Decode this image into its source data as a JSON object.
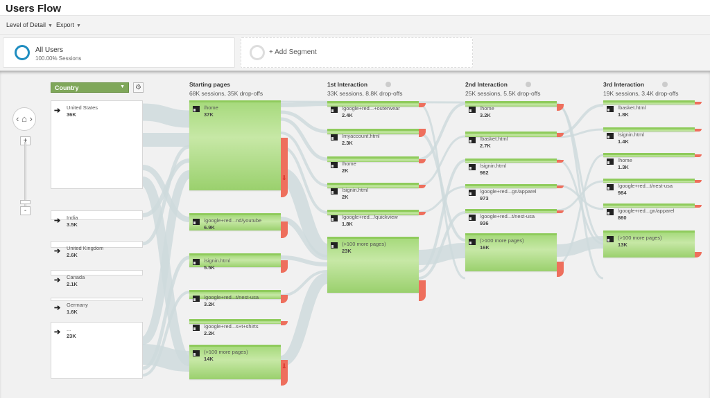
{
  "header": {
    "title": "Users Flow"
  },
  "toolbar": {
    "level_of_detail": "Level of Detail",
    "export": "Export"
  },
  "segments": [
    {
      "name": "All Users",
      "sub": "100.00% Sessions"
    },
    {
      "name": "+ Add Segment"
    }
  ],
  "dimension": {
    "selected": "Country"
  },
  "colors": {
    "node": "#9ad06d",
    "dropoff": "#ee6f5d",
    "flow": "#c9d9dc",
    "segment_ring": "#1f8dc0"
  },
  "countries": [
    {
      "label": "United States",
      "value": "36K"
    },
    {
      "label": "India",
      "value": "3.5K"
    },
    {
      "label": "United Kingdom",
      "value": "2.6K"
    },
    {
      "label": "Canada",
      "value": "2.1K"
    },
    {
      "label": "Germany",
      "value": "1.6K"
    },
    {
      "label": "...",
      "value": "23K"
    }
  ],
  "columns": [
    {
      "title": "Starting pages",
      "summary": "68K sessions, 35K drop-offs",
      "nodes": [
        {
          "label": "/home",
          "value": "37K"
        },
        {
          "label": "/google+red...nd/youtube",
          "value": "6.9K"
        },
        {
          "label": "/signin.html",
          "value": "5.5K"
        },
        {
          "label": "/google+red...t/nest-usa",
          "value": "3.2K"
        },
        {
          "label": "/google+red...s+t+shirts",
          "value": "2.2K"
        },
        {
          "label": "(>100 more pages)",
          "value": "14K"
        }
      ]
    },
    {
      "title": "1st Interaction",
      "summary": "33K sessions, 8.8K drop-offs",
      "nodes": [
        {
          "label": "/google+red...+outerwear",
          "value": "2.4K"
        },
        {
          "label": "/myaccount.html",
          "value": "2.3K"
        },
        {
          "label": "/home",
          "value": "2K"
        },
        {
          "label": "/signin.html",
          "value": "2K"
        },
        {
          "label": "/google+red.../quickview",
          "value": "1.8K"
        },
        {
          "label": "(>100 more pages)",
          "value": "23K"
        }
      ]
    },
    {
      "title": "2nd Interaction",
      "summary": "25K sessions, 5.5K drop-offs",
      "nodes": [
        {
          "label": "/home",
          "value": "3.2K"
        },
        {
          "label": "/basket.html",
          "value": "2.7K"
        },
        {
          "label": "/signin.html",
          "value": "982"
        },
        {
          "label": "/google+red...gn/apparel",
          "value": "973"
        },
        {
          "label": "/google+red...t/nest-usa",
          "value": "936"
        },
        {
          "label": "(>100 more pages)",
          "value": "16K"
        }
      ]
    },
    {
      "title": "3rd Interaction",
      "summary": "19K sessions, 3.4K drop-offs",
      "nodes": [
        {
          "label": "/basket.html",
          "value": "1.8K"
        },
        {
          "label": "/signin.html",
          "value": "1.4K"
        },
        {
          "label": "/home",
          "value": "1.3K"
        },
        {
          "label": "/google+red...t/nest-usa",
          "value": "984"
        },
        {
          "label": "/google+red...gn/apparel",
          "value": "860"
        },
        {
          "label": "(>100 more pages)",
          "value": "13K"
        }
      ]
    }
  ]
}
